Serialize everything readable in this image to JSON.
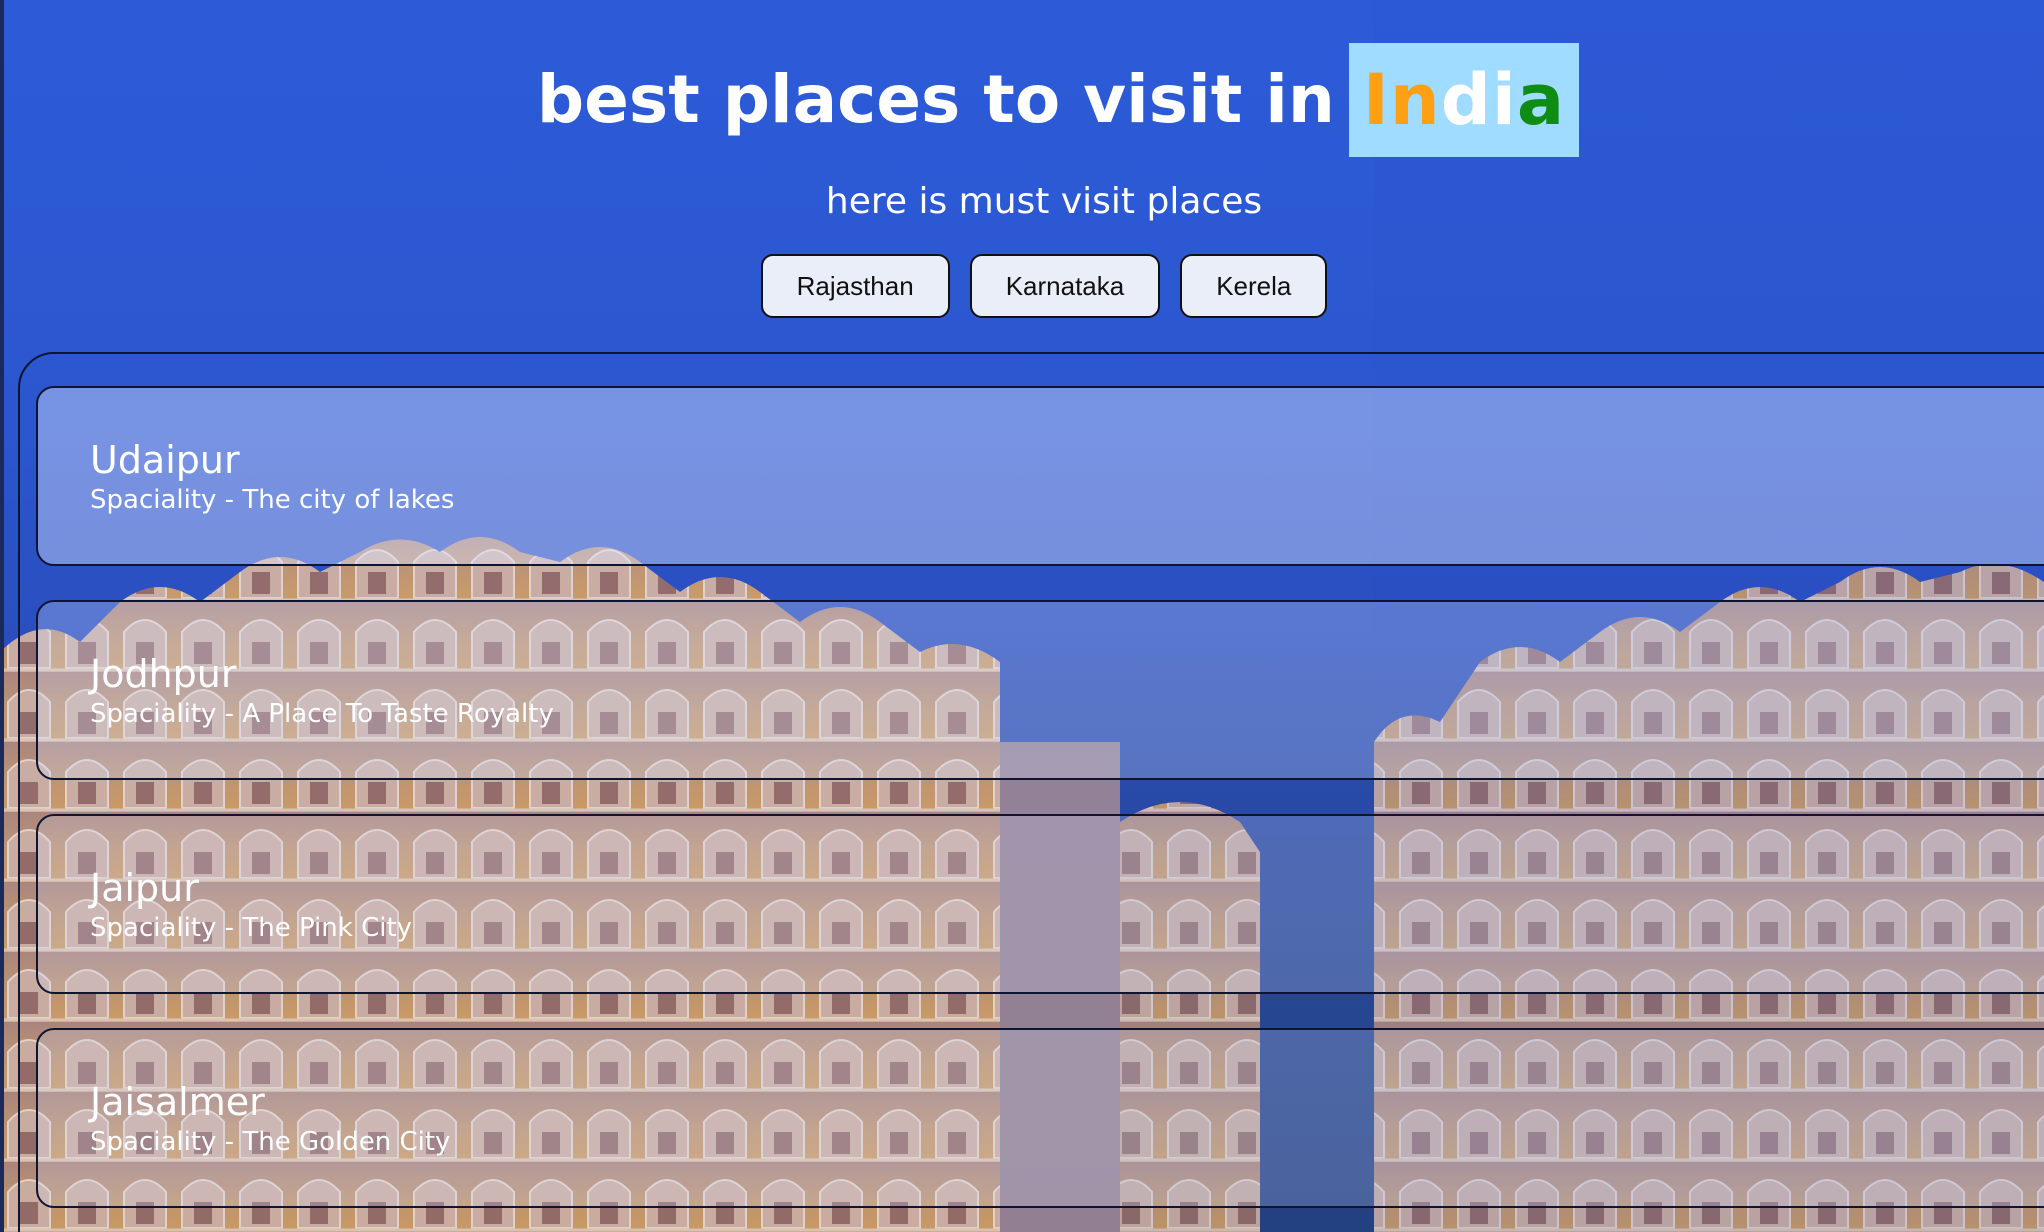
{
  "header": {
    "title": "best places to visit in",
    "india": {
      "part1": "In",
      "part2": "di",
      "part3": "a"
    },
    "subtitle": "here is must visit places"
  },
  "buttons": [
    {
      "label": "Rajasthan"
    },
    {
      "label": "Karnataka"
    },
    {
      "label": "Kerela"
    }
  ],
  "places": [
    {
      "name": "Udaipur",
      "speciality": "Spaciality - The city of lakes"
    },
    {
      "name": "Jodhpur",
      "speciality": "Spaciality - A Place To Taste Royalty"
    },
    {
      "name": "Jaipur",
      "speciality": "Spaciality - The Pink City"
    },
    {
      "name": "Jaisalmer",
      "speciality": "Spaciality - The Golden City"
    }
  ],
  "colors": {
    "india_box_bg": "#9fdcff",
    "india_orange": "#ff9f14",
    "india_white": "#ffffff",
    "india_green": "#0f8c14"
  }
}
